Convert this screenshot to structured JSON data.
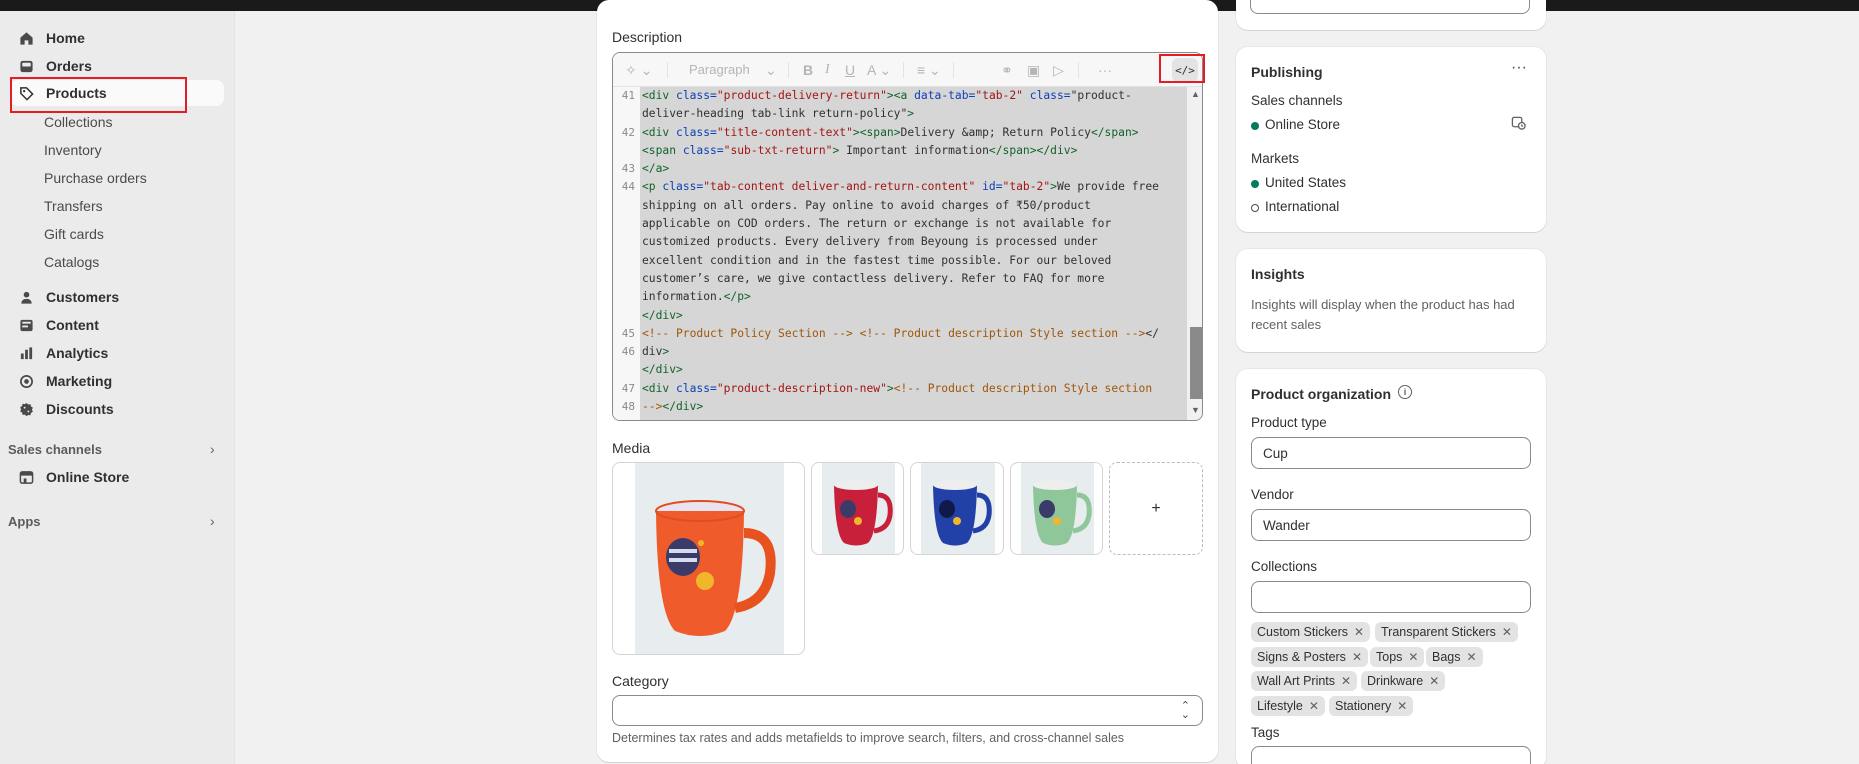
{
  "sidebar": {
    "items": [
      {
        "label": "Home",
        "icon": "home-icon"
      },
      {
        "label": "Orders",
        "icon": "inbox-icon"
      },
      {
        "label": "Products",
        "icon": "tag-icon"
      }
    ],
    "product_sub": [
      "Collections",
      "Inventory",
      "Purchase orders",
      "Transfers",
      "Gift cards",
      "Catalogs"
    ],
    "items2": [
      {
        "label": "Customers",
        "icon": "person-icon"
      },
      {
        "label": "Content",
        "icon": "image-icon"
      },
      {
        "label": "Analytics",
        "icon": "bar-chart-icon"
      },
      {
        "label": "Marketing",
        "icon": "target-icon"
      },
      {
        "label": "Discounts",
        "icon": "discount-icon"
      }
    ],
    "sales_channels_label": "Sales channels",
    "online_store": "Online Store",
    "apps_label": "Apps"
  },
  "description": {
    "label": "Description",
    "toolbar": {
      "paragraph": "Paragraph",
      "code_icon": "code-icon"
    },
    "line_numbers": [
      "41",
      "42",
      "43",
      "44",
      "45",
      "46",
      "47",
      "48"
    ],
    "code_lines": [
      "<div class=\"product-delivery-return\"><a data-tab=\"tab-2\" class=\"product-",
      "deliver-heading tab-link return-policy\">",
      "<div class=\"title-content-text\"><span>Delivery &amp; Return Policy</span>",
      "<span class=\"sub-txt-return\"> Important information</span></div>",
      "</a>",
      "<p class=\"tab-content deliver-and-return-content\" id=\"tab-2\">We provide free",
      "shipping on all orders. Pay online to avoid charges of ₹50/product",
      "applicable on COD orders. The return or exchange is not available for",
      "customized products. Every delivery from Beyoung is processed under",
      "excellent condition and in the fastest time possible. For our beloved",
      "customer’s care, we give contactless delivery. Refer to FAQ for more",
      "information.</p>",
      "</div>",
      "<!-- Product Policy Section --> <!-- Product description Style section --></",
      "div>",
      "</div>",
      "<div class=\"product-description-new\"><!-- Product description Style section",
      "--></div>"
    ]
  },
  "media": {
    "label": "Media",
    "add": "+"
  },
  "category": {
    "label": "Category",
    "help": "Determines tax rates and adds metafields to improve search, filters, and cross-channel sales"
  },
  "publishing": {
    "title": "Publishing",
    "sales_channels": "Sales channels",
    "online_store": "Online Store",
    "markets": "Markets",
    "united_states": "United States",
    "international": "International"
  },
  "insights": {
    "title": "Insights",
    "text": "Insights will display when the product has had recent sales"
  },
  "organization": {
    "title": "Product organization",
    "product_type_label": "Product type",
    "product_type": "Cup",
    "vendor_label": "Vendor",
    "vendor": "Wander",
    "collections_label": "Collections",
    "collections_value": "",
    "chips": [
      "Custom Stickers",
      "Transparent Stickers",
      "Signs & Posters",
      "Tops",
      "Bags",
      "Wall Art Prints",
      "Drinkware",
      "Lifestyle",
      "Stationery"
    ],
    "tags_label": "Tags"
  },
  "colors": {
    "accent": "#e51c23",
    "active_dot": "#047b5d"
  }
}
